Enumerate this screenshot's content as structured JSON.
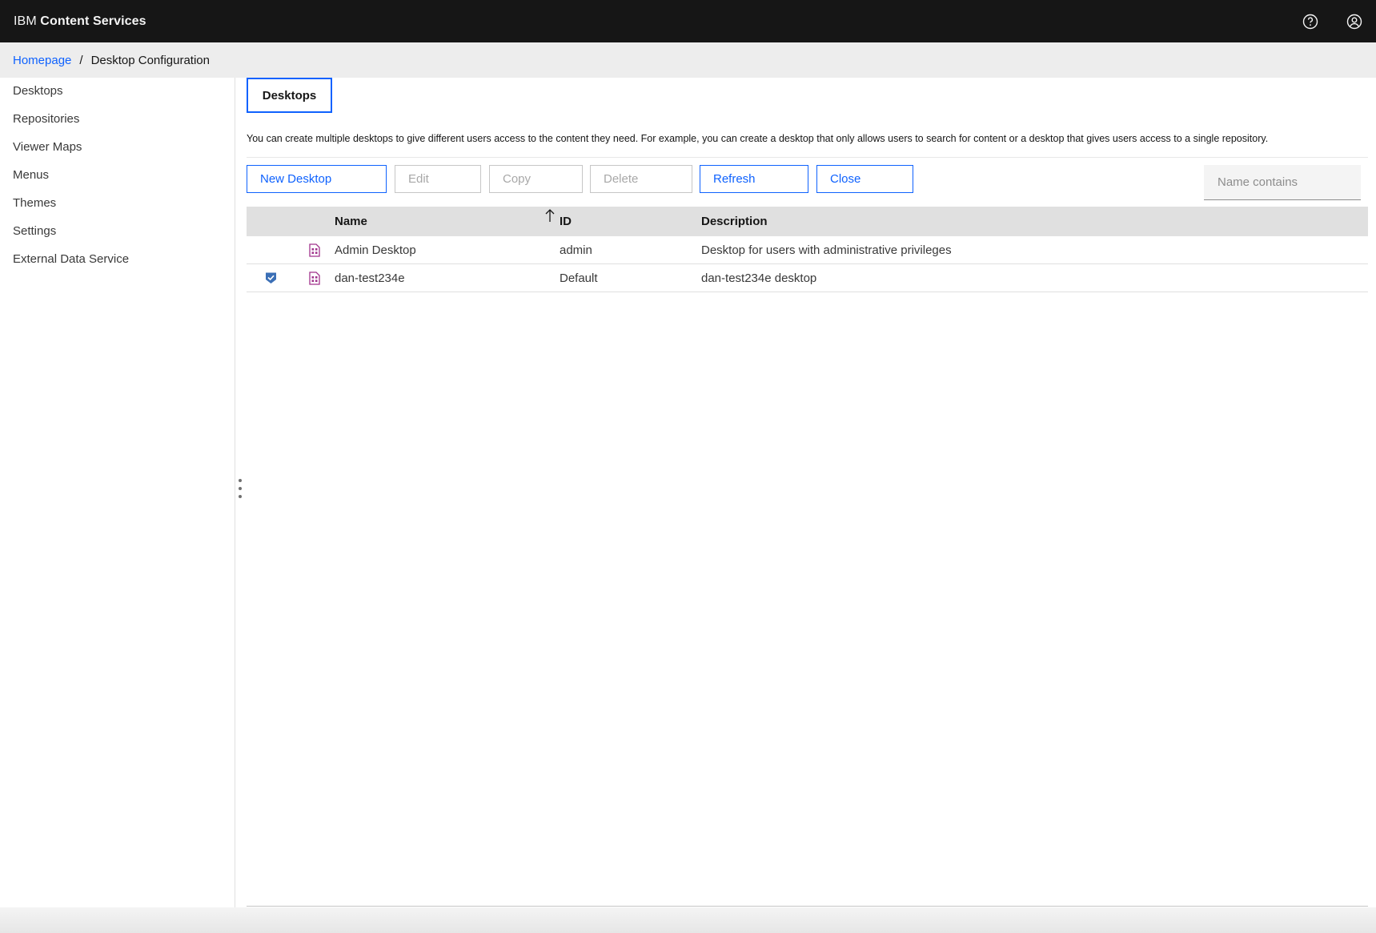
{
  "header": {
    "brand_prefix": "IBM",
    "brand_name": "Content Services",
    "icons": [
      "help-icon",
      "user-avatar-icon"
    ]
  },
  "breadcrumb": {
    "home": "Homepage",
    "separator": "/",
    "current": "Desktop Configuration"
  },
  "sidebar": {
    "items": [
      {
        "label": "Desktops"
      },
      {
        "label": "Repositories"
      },
      {
        "label": "Viewer Maps"
      },
      {
        "label": "Menus"
      },
      {
        "label": "Themes"
      },
      {
        "label": "Settings"
      },
      {
        "label": "External Data Service"
      }
    ]
  },
  "main": {
    "tab_label": "Desktops",
    "description": "You can create multiple desktops to give different users access to the content they need. For example, you can create a desktop that only allows users to search for content or a desktop that gives users access to a single repository.",
    "toolbar": {
      "new_desktop": "New Desktop",
      "edit": "Edit",
      "copy": "Copy",
      "delete": "Delete",
      "refresh": "Refresh",
      "close": "Close"
    },
    "filter_placeholder": "Name contains",
    "table": {
      "columns": {
        "name": "Name",
        "id": "ID",
        "description": "Description"
      },
      "sort": {
        "column": "Name",
        "direction": "ascending"
      },
      "rows": [
        {
          "default": false,
          "name": "Admin Desktop",
          "id": "admin",
          "description": "Desktop for users with administrative privileges"
        },
        {
          "default": true,
          "name": "dan-test234e",
          "id": "Default",
          "description": "dan-test234e desktop"
        }
      ]
    }
  },
  "colors": {
    "accent": "#0f62fe",
    "header_bg": "#161616",
    "desktop_icon": "#a1338c",
    "default_badge": "#3b6fb6"
  }
}
